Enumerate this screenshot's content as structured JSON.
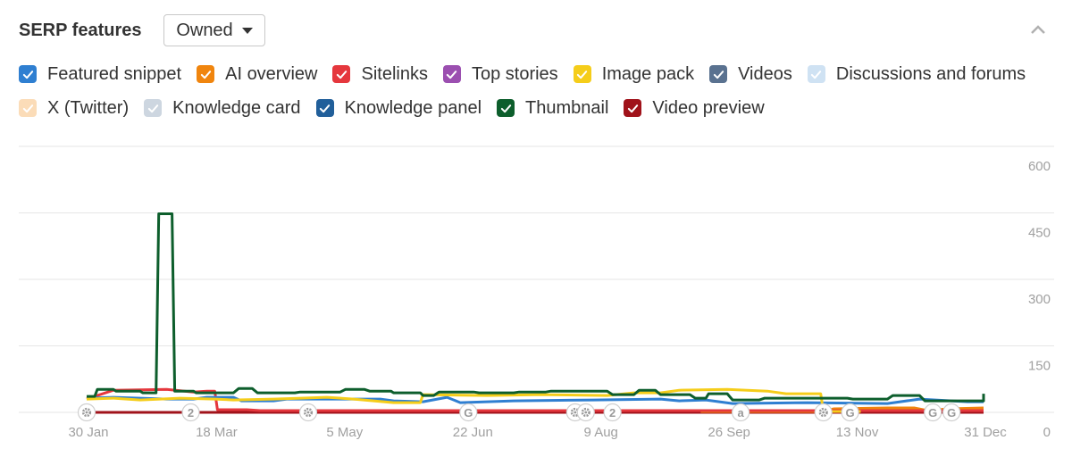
{
  "header": {
    "title": "SERP features",
    "dropdown_value": "Owned",
    "collapse_icon": "chevron-up-icon"
  },
  "legend": {
    "rows": [
      [
        {
          "label": "Featured snippet",
          "color": "#2f7fd1",
          "checked": true
        },
        {
          "label": "AI overview",
          "color": "#f0850e",
          "checked": true
        },
        {
          "label": "Sitelinks",
          "color": "#e5373d",
          "checked": true
        },
        {
          "label": "Top stories",
          "color": "#9b4fb0",
          "checked": true
        },
        {
          "label": "Image pack",
          "color": "#f5cd1a",
          "checked": true
        },
        {
          "label": "Videos",
          "color": "#5a7290",
          "checked": true
        },
        {
          "label": "Discussions and forums",
          "color": "#cfe2f3",
          "checked": true
        }
      ],
      [
        {
          "label": "X (Twitter)",
          "color": "#fbdcb8",
          "checked": true
        },
        {
          "label": "Knowledge card",
          "color": "#cdd6e0",
          "checked": true
        },
        {
          "label": "Knowledge panel",
          "color": "#215f9a",
          "checked": true
        },
        {
          "label": "Thumbnail",
          "color": "#0d5e2c",
          "checked": true
        },
        {
          "label": "Video preview",
          "color": "#a0121a",
          "checked": true
        }
      ]
    ]
  },
  "chart_data": {
    "type": "line",
    "title": "SERP features",
    "xlabel": "",
    "ylabel": "",
    "x_ticks": [
      "30 Jan",
      "18 Mar",
      "5 May",
      "22 Jun",
      "9 Aug",
      "26 Sep",
      "13 Nov",
      "31 Dec"
    ],
    "x_range_days": [
      0,
      336
    ],
    "y_ticks": [
      0,
      150,
      300,
      450,
      600
    ],
    "ylim": [
      0,
      600
    ],
    "y_axis_side": "right",
    "grid": true,
    "series": [
      {
        "name": "Thumbnail",
        "color": "#0d5e2c",
        "points": [
          [
            0,
            36
          ],
          [
            3,
            36
          ],
          [
            4,
            52
          ],
          [
            10,
            52
          ],
          [
            11,
            48
          ],
          [
            20,
            48
          ],
          [
            21,
            44
          ],
          [
            26,
            44
          ],
          [
            27,
            448
          ],
          [
            32,
            448
          ],
          [
            33,
            48
          ],
          [
            40,
            48
          ],
          [
            41,
            44
          ],
          [
            55,
            44
          ],
          [
            57,
            54
          ],
          [
            62,
            54
          ],
          [
            64,
            44
          ],
          [
            78,
            44
          ],
          [
            80,
            46
          ],
          [
            95,
            46
          ],
          [
            97,
            52
          ],
          [
            104,
            52
          ],
          [
            106,
            48
          ],
          [
            114,
            48
          ],
          [
            115,
            44
          ],
          [
            125,
            44
          ],
          [
            126,
            38
          ],
          [
            130,
            38
          ],
          [
            132,
            46
          ],
          [
            145,
            46
          ],
          [
            147,
            44
          ],
          [
            160,
            44
          ],
          [
            162,
            46
          ],
          [
            172,
            46
          ],
          [
            174,
            48
          ],
          [
            195,
            48
          ],
          [
            197,
            40
          ],
          [
            205,
            40
          ],
          [
            207,
            50
          ],
          [
            213,
            50
          ],
          [
            215,
            40
          ],
          [
            226,
            40
          ],
          [
            228,
            32
          ],
          [
            232,
            32
          ],
          [
            233,
            42
          ],
          [
            240,
            42
          ],
          [
            242,
            28
          ],
          [
            252,
            28
          ],
          [
            254,
            32
          ],
          [
            285,
            32
          ],
          [
            287,
            30
          ],
          [
            300,
            30
          ],
          [
            302,
            38
          ],
          [
            312,
            38
          ],
          [
            314,
            26
          ],
          [
            336,
            26
          ],
          [
            336,
            42
          ]
        ]
      },
      {
        "name": "Image pack",
        "color": "#f5cd1a",
        "points": [
          [
            0,
            30
          ],
          [
            10,
            32
          ],
          [
            20,
            28
          ],
          [
            35,
            32
          ],
          [
            48,
            30
          ],
          [
            55,
            28
          ],
          [
            70,
            30
          ],
          [
            90,
            34
          ],
          [
            100,
            30
          ],
          [
            115,
            22
          ],
          [
            125,
            22
          ],
          [
            126,
            40
          ],
          [
            150,
            38
          ],
          [
            170,
            40
          ],
          [
            195,
            38
          ],
          [
            205,
            44
          ],
          [
            215,
            44
          ],
          [
            222,
            50
          ],
          [
            240,
            52
          ],
          [
            255,
            48
          ],
          [
            262,
            42
          ],
          [
            275,
            42
          ],
          [
            276,
            2
          ],
          [
            290,
            2
          ]
        ]
      },
      {
        "name": "Featured snippet",
        "color": "#2f7fd1",
        "points": [
          [
            0,
            32
          ],
          [
            10,
            34
          ],
          [
            30,
            30
          ],
          [
            40,
            30
          ],
          [
            45,
            34
          ],
          [
            55,
            34
          ],
          [
            58,
            26
          ],
          [
            70,
            26
          ],
          [
            75,
            30
          ],
          [
            110,
            30
          ],
          [
            115,
            26
          ],
          [
            126,
            24
          ],
          [
            135,
            34
          ],
          [
            140,
            22
          ],
          [
            160,
            26
          ],
          [
            190,
            28
          ],
          [
            215,
            30
          ],
          [
            222,
            26
          ],
          [
            232,
            28
          ],
          [
            242,
            20
          ],
          [
            270,
            22
          ],
          [
            300,
            20
          ],
          [
            312,
            30
          ],
          [
            330,
            24
          ],
          [
            336,
            24
          ]
        ]
      },
      {
        "name": "Sitelinks",
        "color": "#e5373d",
        "points": [
          [
            0,
            30
          ],
          [
            10,
            50
          ],
          [
            30,
            52
          ],
          [
            40,
            46
          ],
          [
            45,
            48
          ],
          [
            48,
            48
          ],
          [
            49,
            6
          ],
          [
            60,
            6
          ],
          [
            65,
            4
          ],
          [
            150,
            4
          ],
          [
            200,
            4
          ],
          [
            336,
            4
          ]
        ]
      },
      {
        "name": "AI overview",
        "color": "#f0850e",
        "points": [
          [
            230,
            2
          ],
          [
            275,
            2
          ],
          [
            280,
            8
          ],
          [
            300,
            10
          ],
          [
            310,
            10
          ],
          [
            315,
            4
          ],
          [
            323,
            8
          ],
          [
            336,
            10
          ]
        ]
      },
      {
        "name": "Video preview",
        "color": "#a0121a",
        "points": [
          [
            0,
            0
          ],
          [
            336,
            0
          ]
        ]
      }
    ],
    "annotations": [
      {
        "day": 0,
        "icon": "gear"
      },
      {
        "day": 39,
        "icon": "2"
      },
      {
        "day": 83,
        "icon": "gear"
      },
      {
        "day": 143,
        "icon": "G"
      },
      {
        "day": 183,
        "icon": "gear"
      },
      {
        "day": 187,
        "icon": "gear"
      },
      {
        "day": 197,
        "icon": "2"
      },
      {
        "day": 245,
        "icon": "a"
      },
      {
        "day": 276,
        "icon": "gear"
      },
      {
        "day": 286,
        "icon": "G"
      },
      {
        "day": 317,
        "icon": "G"
      },
      {
        "day": 324,
        "icon": "G"
      }
    ]
  }
}
